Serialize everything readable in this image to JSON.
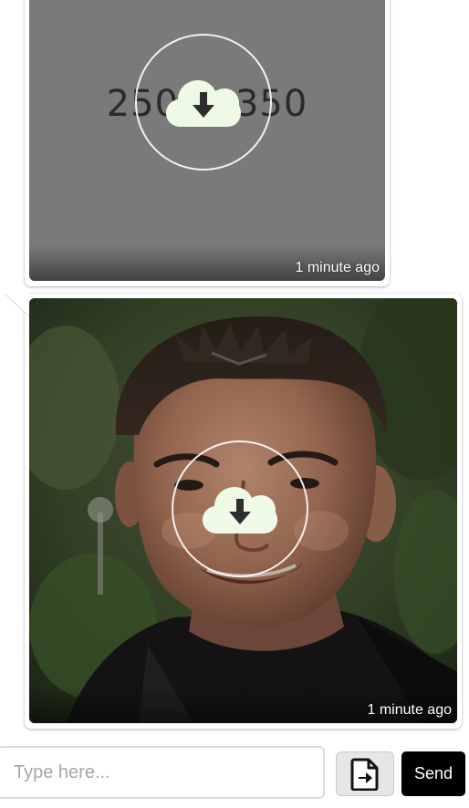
{
  "messages": [
    {
      "kind": "image",
      "image_alt": "250 × 350 placeholder",
      "placeholder_text": "250 × 350",
      "timestamp": "1 minute ago",
      "download_icon": "cloud-download-icon"
    },
    {
      "kind": "image",
      "image_alt": "Photo of a smiling man",
      "timestamp": "1 minute ago",
      "download_icon": "cloud-download-icon"
    }
  ],
  "composer": {
    "placeholder": "Type here...",
    "value": "",
    "attach_icon": "file-attach-icon",
    "send_label": "Send"
  },
  "colors": {
    "placeholder_bg": "#7a7a7a",
    "cloud_fill": "#eefae6",
    "send_bg": "#000000",
    "send_text": "#ffffff"
  }
}
